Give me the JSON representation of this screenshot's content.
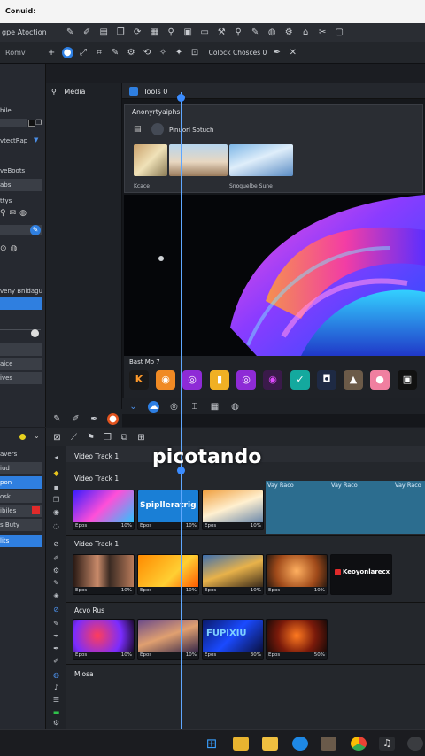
{
  "window": {
    "title": "Conuid:"
  },
  "menubar": {
    "label": "gpe Atoction"
  },
  "toolbar2": {
    "left_label": "Romv",
    "mode_label": "Colock Chosces 0"
  },
  "left_panel": {
    "items": [
      "bile",
      "vtectRap",
      "veBoots",
      "abs",
      "ttys",
      "veny Bnidagut",
      "aice",
      "ives"
    ]
  },
  "left_panel2": {
    "items": [
      "avers",
      "iud",
      "pon",
      "osk",
      "ibiles",
      "s Buty",
      "lits"
    ]
  },
  "media": {
    "title": "Media"
  },
  "preview": {
    "tab": "Tools 0",
    "panel_title": "Anonyrtyaiphs",
    "section": "Pinuorl Sotuch",
    "thumb_caption": "Snoguelbe Sune",
    "small_caption": "Kcace",
    "apps_title": "Bast Mo 7"
  },
  "timeline": {
    "video_track_1": "Video Track 1",
    "video_track_1b": "Video Track 1",
    "video_track_2": "Video Track 1",
    "audio_track": "Acvo Rus",
    "track_4": "Mlosa",
    "band_labels": [
      "Vay Raco",
      "Vay Raco",
      "Vay Raco"
    ],
    "row1": [
      {
        "cap": "Epos",
        "pct": "10%",
        "text": ""
      },
      {
        "cap": "Epos",
        "pct": "10%",
        "text": "Spiplleratrig"
      },
      {
        "cap": "Epos",
        "pct": "10%",
        "text": ""
      }
    ],
    "row2": [
      {
        "cap": "Epos",
        "pct": "10%",
        "text": ""
      },
      {
        "cap": "Epos",
        "pct": "10%",
        "text": ""
      },
      {
        "cap": "Epos",
        "pct": "10%",
        "text": ""
      },
      {
        "cap": "Epos",
        "pct": "10%",
        "text": ""
      },
      {
        "cap": "",
        "pct": "",
        "text": "Keoyonlarecx"
      }
    ],
    "row3": [
      {
        "cap": "Epos",
        "pct": "10%",
        "text": ""
      },
      {
        "cap": "Epos",
        "pct": "10%",
        "text": ""
      },
      {
        "cap": "Epos",
        "pct": "30%",
        "text": "FUPIXIU"
      },
      {
        "cap": "Epos",
        "pct": "50%",
        "text": ""
      }
    ]
  },
  "watermark": "picotando",
  "colors": {
    "accent": "#2f7fe0",
    "bg": "#1b1d22"
  }
}
